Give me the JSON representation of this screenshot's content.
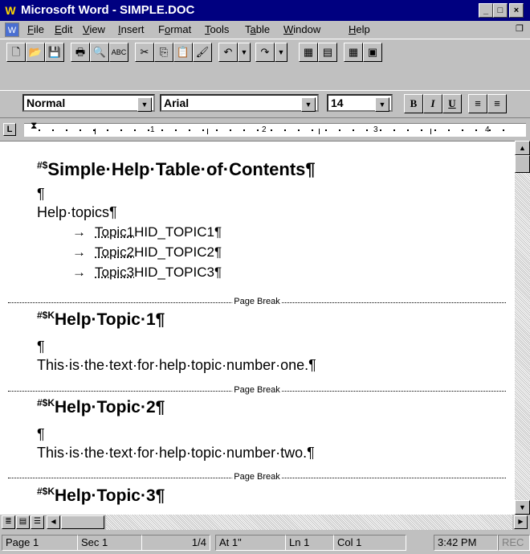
{
  "window": {
    "title": "Microsoft Word - SIMPLE.DOC",
    "min_label": "_",
    "max_label": "□",
    "close_label": "×"
  },
  "menu": {
    "items": [
      "File",
      "Edit",
      "View",
      "Insert",
      "Format",
      "Tools",
      "Table",
      "Window",
      "Help"
    ]
  },
  "toolbar_standard": {
    "icons": [
      "new-icon",
      "open-icon",
      "save-icon",
      "print-icon",
      "print-preview-icon",
      "spelling-icon",
      "cut-icon",
      "copy-icon",
      "paste-icon",
      "format-painter-icon",
      "undo-icon",
      "undo-dropdown-icon",
      "redo-icon",
      "redo-dropdown-icon",
      "insert-frame-icon",
      "toolbar-icon",
      "insert-table-icon",
      "insert-excel-icon"
    ]
  },
  "toolbar_formatting": {
    "style_value": "Normal",
    "font_value": "Arial",
    "size_value": "14",
    "bold_label": "B",
    "italic_label": "I",
    "underline_label": "U"
  },
  "ruler": {
    "numbers": [
      "1",
      "2",
      "3",
      "4"
    ]
  },
  "document": {
    "heading_marks": "#$",
    "heading": "Simple·Help·Table·of·Contents¶",
    "empty_para": "¶",
    "help_topics": "Help·topics¶",
    "topics": [
      {
        "link": "Topic1",
        "id": "HID_TOPIC1¶"
      },
      {
        "link": "Topic2",
        "id": "HID_TOPIC2¶"
      },
      {
        "link": "Topic3",
        "id": "HID_TOPIC3¶"
      }
    ],
    "page_break_label": "Page Break",
    "sections": [
      {
        "marks": "#$K",
        "title": "Help·Topic·1¶",
        "empty": "¶",
        "body": "This·is·the·text·for·help·topic·number·one.¶"
      },
      {
        "marks": "#$K",
        "title": "Help·Topic·2¶",
        "empty": "¶",
        "body": "This·is·the·text·for·help·topic·number·two.¶"
      },
      {
        "marks": "#$K",
        "title": "Help·Topic·3¶"
      }
    ]
  },
  "status": {
    "page": "Page 1",
    "sec": "Sec 1",
    "pages": "1/4",
    "at": "At 1\"",
    "ln": "Ln 1",
    "col": "Col 1",
    "time": "3:42 PM",
    "rec": "REC"
  }
}
